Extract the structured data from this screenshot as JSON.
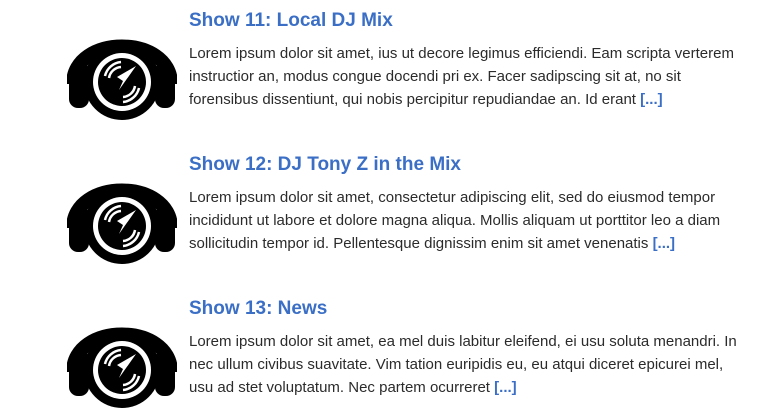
{
  "posts": [
    {
      "title": "Show 11: Local DJ Mix",
      "excerpt": "Lorem ipsum dolor sit amet, ius ut decore legimus efficiendi. Eam scripta verterem instructior an, modus congue docendi pri ex. Facer sadipscing sit at, no sit forensibus dissentiunt, qui nobis percipitur repudiandae an. Id erant",
      "more": "[...]",
      "image_icon": "dj-headphones-record-icon"
    },
    {
      "title": "Show 12: DJ Tony Z in the Mix",
      "excerpt": "Lorem ipsum dolor sit amet, consectetur adipiscing elit, sed do eiusmod tempor incididunt ut labore et dolore magna aliqua. Mollis aliquam ut porttitor leo a diam sollicitudin tempor id. Pellentesque dignissim enim sit amet venenatis",
      "more": "[...]",
      "image_icon": "dj-headphones-record-icon"
    },
    {
      "title": "Show 13: News",
      "excerpt": "Lorem ipsum dolor sit amet, ea mel duis labitur eleifend, ei usu soluta menandri. In nec ullum civibus suavitate. Vim tation euripidis eu, eu atqui diceret epicurei mel, usu ad stet voluptatum. Nec partem ocurreret",
      "more": "[...]",
      "image_icon": "dj-headphones-record-icon"
    }
  ],
  "colors": {
    "link": "#3b6fc6",
    "text": "#2b2b2b",
    "icon": "#000000"
  }
}
